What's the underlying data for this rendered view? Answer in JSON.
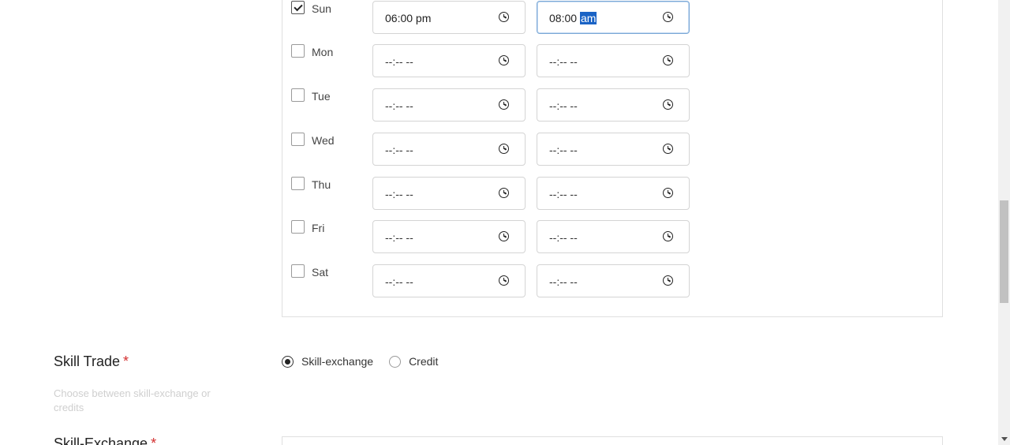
{
  "availability": {
    "days": [
      {
        "label": "Sun",
        "checked": true,
        "start": "06:00 pm",
        "end_time": "08:00",
        "end_period": "am"
      },
      {
        "label": "Mon",
        "checked": false,
        "start": "--:-- --",
        "end": "--:-- --"
      },
      {
        "label": "Tue",
        "checked": false,
        "start": "--:-- --",
        "end": "--:-- --"
      },
      {
        "label": "Wed",
        "checked": false,
        "start": "--:-- --",
        "end": "--:-- --"
      },
      {
        "label": "Thu",
        "checked": false,
        "start": "--:-- --",
        "end": "--:-- --"
      },
      {
        "label": "Fri",
        "checked": false,
        "start": "--:-- --",
        "end": "--:-- --"
      },
      {
        "label": "Sat",
        "checked": false,
        "start": "--:-- --",
        "end": "--:-- --"
      }
    ]
  },
  "skill_trade": {
    "title": "Skill Trade",
    "required_mark": "*",
    "description": "Choose between skill-exchange or credits",
    "options": [
      {
        "label": "Skill-exchange",
        "selected": true
      },
      {
        "label": "Credit",
        "selected": false
      }
    ]
  },
  "next_section": {
    "title": "Skill-Exchange",
    "required_mark": "*"
  },
  "icons": {
    "time": "clock-icon"
  }
}
